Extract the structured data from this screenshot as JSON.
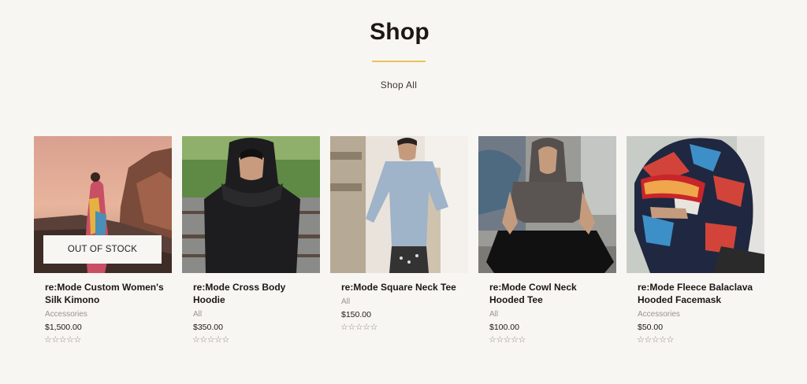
{
  "header": {
    "title": "Shop",
    "shop_all_label": "Shop All"
  },
  "products": [
    {
      "name": "re:Mode Custom Women's Silk Kimono",
      "category": "Accessories",
      "price": "$1,500.00",
      "badge": "OUT OF STOCK",
      "rating_stars": "☆☆☆☆☆",
      "rating": 0
    },
    {
      "name": "re:Mode Cross Body Hoodie",
      "category": "All",
      "price": "$350.00",
      "rating_stars": "☆☆☆☆☆",
      "rating": 0
    },
    {
      "name": "re:Mode Square Neck Tee",
      "category": "All",
      "price": "$150.00",
      "rating_stars": "☆☆☆☆☆",
      "rating": 0
    },
    {
      "name": "re:Mode Cowl Neck Hooded Tee",
      "category": "All",
      "price": "$100.00",
      "rating_stars": "☆☆☆☆☆",
      "rating": 0
    },
    {
      "name": "re:Mode Fleece Balaclava Hooded Facemask",
      "category": "Accessories",
      "price": "$50.00",
      "rating_stars": "☆☆☆☆☆",
      "rating": 0
    }
  ],
  "colors": {
    "background": "#f8f6f3",
    "accent_divider": "#e9c25a",
    "text": "#1c1714",
    "muted": "#9a938c"
  }
}
